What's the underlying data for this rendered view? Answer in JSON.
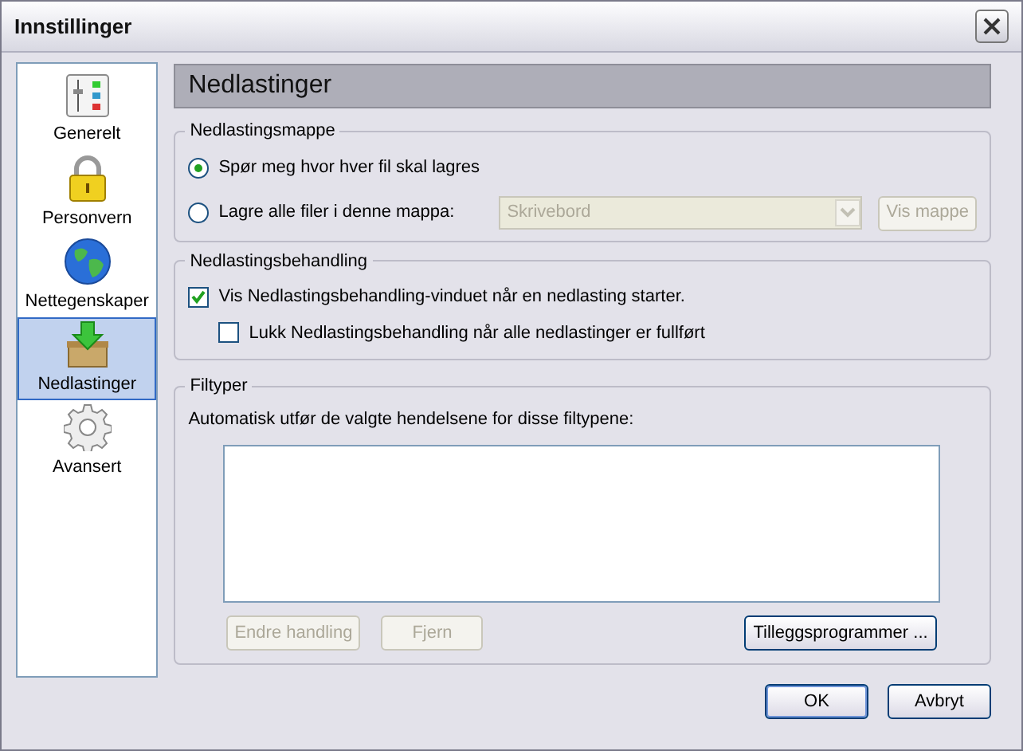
{
  "window": {
    "title": "Innstillinger"
  },
  "sidebar": {
    "items": [
      {
        "label": "Generelt",
        "kind": "general",
        "selected": false
      },
      {
        "label": "Personvern",
        "kind": "privacy",
        "selected": false
      },
      {
        "label": "Nettegenskaper",
        "kind": "network",
        "selected": false
      },
      {
        "label": "Nedlastinger",
        "kind": "downloads",
        "selected": true
      },
      {
        "label": "Avansert",
        "kind": "advanced",
        "selected": false
      }
    ]
  },
  "header": {
    "title": "Nedlastinger"
  },
  "download_folder": {
    "title": "Nedlastingsmappe",
    "options": [
      {
        "label": "Spør meg hvor hver fil skal lagres",
        "selected": true
      },
      {
        "label": "Lagre alle filer i denne mappa:",
        "selected": false
      }
    ],
    "folder_select": {
      "value": "Skrivebord",
      "disabled": true
    },
    "show_folder_button": {
      "label": "Vis mappe",
      "disabled": true
    }
  },
  "download_manager": {
    "title": "Nedlastingsbehandling",
    "options": [
      {
        "label": "Vis Nedlastingsbehandling-vinduet når en nedlasting starter.",
        "checked": true,
        "children": [
          {
            "label": "Lukk Nedlastingsbehandling når alle nedlastinger er fullført",
            "checked": false
          }
        ]
      }
    ]
  },
  "file_types": {
    "title": "Filtyper",
    "description": "Automatisk utfør de valgte hendelsene for disse filtypene:",
    "buttons": [
      {
        "label": "Endre handling",
        "disabled": true
      },
      {
        "label": "Fjern",
        "disabled": true
      },
      {
        "label": "Tilleggsprogrammer ...",
        "disabled": false
      }
    ]
  },
  "dialog_buttons": [
    {
      "label": "OK",
      "default": true
    },
    {
      "label": "Avbryt",
      "default": false
    }
  ]
}
